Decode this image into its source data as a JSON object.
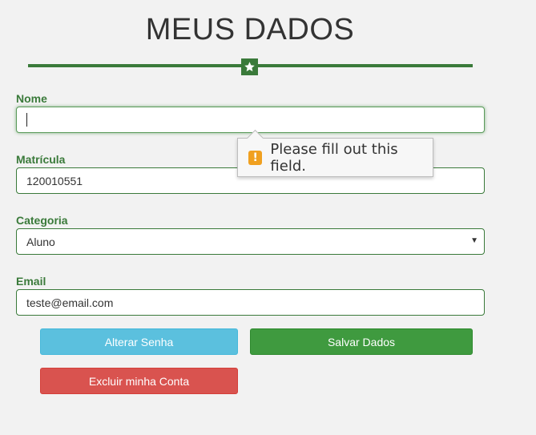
{
  "page": {
    "title": "MEUS DADOS"
  },
  "form": {
    "nome": {
      "label": "Nome",
      "value": ""
    },
    "matricula": {
      "label": "Matrícula",
      "value": "120010551"
    },
    "categoria": {
      "label": "Categoria",
      "selected": "Aluno"
    },
    "email": {
      "label": "Email",
      "value": "teste@email.com"
    }
  },
  "validation": {
    "message": "Please fill out this field.",
    "icon": "warning-icon"
  },
  "buttons": {
    "change_password": "Alterar Senha",
    "save": "Salvar Dados",
    "delete_account": "Excluir minha Conta"
  },
  "colors": {
    "accent": "#3a7a3a",
    "info": "#5bc0de",
    "success": "#3f9a3f",
    "danger": "#d9534f",
    "warning": "#f0a020"
  }
}
